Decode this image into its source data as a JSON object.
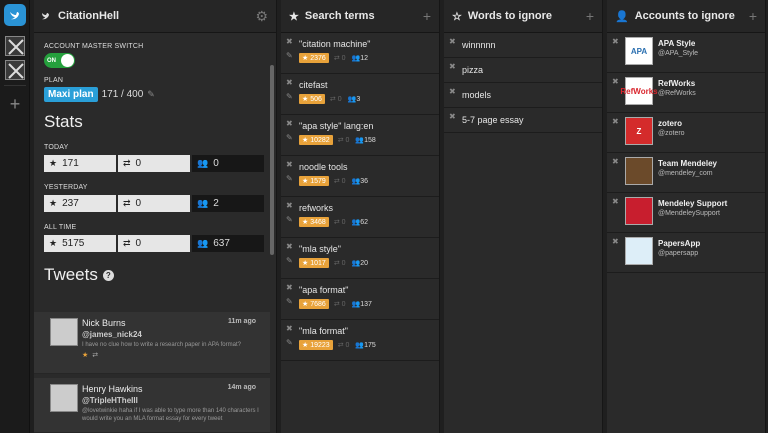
{
  "colors": {
    "accent": "#2a9fd8",
    "orange": "#e8a23a",
    "toggle_on": "#25a03d"
  },
  "account_column": {
    "title": "CitationHell",
    "master_switch_label": "ACCOUNT MASTER SWITCH",
    "toggle_label": "ON",
    "plan_label": "PLAN",
    "plan_name": "Maxi plan",
    "plan_usage": "171 / 400",
    "stats_title": "Stats",
    "periods": [
      {
        "label": "TODAY",
        "stars": "171",
        "retweets": "0",
        "followers": "0"
      },
      {
        "label": "YESTERDAY",
        "stars": "237",
        "retweets": "0",
        "followers": "2"
      },
      {
        "label": "ALL TIME",
        "stars": "5175",
        "retweets": "0",
        "followers": "637"
      }
    ],
    "tweets_title": "Tweets",
    "tweets": [
      {
        "name": "Nick Burns",
        "handle": "@james_nick24",
        "text": "I have no clue how to write a research paper in APA format?",
        "time": "11m ago"
      },
      {
        "name": "Henry Hawkins",
        "handle": "@TripleHTheIII",
        "text": "@lovetwinkie haha if I was able to type more than 140 characters I would write you an MLA format essay for every tweet",
        "time": "14m ago"
      }
    ]
  },
  "search_column": {
    "title": "Search terms",
    "terms": [
      {
        "term": "\"citation machine\"",
        "stars": "2376",
        "retweets": "0",
        "users": "12"
      },
      {
        "term": "citefast",
        "stars": "506",
        "retweets": "0",
        "users": "3"
      },
      {
        "term": "\"apa style\" lang:en",
        "stars": "10282",
        "retweets": "0",
        "users": "158"
      },
      {
        "term": "noodle tools",
        "stars": "1579",
        "retweets": "0",
        "users": "36"
      },
      {
        "term": "refworks",
        "stars": "3468",
        "retweets": "0",
        "users": "62"
      },
      {
        "term": "\"mla style\"",
        "stars": "1017",
        "retweets": "0",
        "users": "20"
      },
      {
        "term": "\"apa format\"",
        "stars": "7686",
        "retweets": "0",
        "users": "137"
      },
      {
        "term": "\"mla format\"",
        "stars": "19223",
        "retweets": "0",
        "users": "175"
      }
    ]
  },
  "ignore_words_column": {
    "title": "Words to ignore",
    "words": [
      "winnnnn",
      "pizza",
      "models",
      "5-7 page essay"
    ]
  },
  "ignore_accounts_column": {
    "title": "Accounts to ignore",
    "accounts": [
      {
        "name": "APA Style",
        "handle": "@APA_Style",
        "logo": "APA"
      },
      {
        "name": "RefWorks",
        "handle": "@RefWorks",
        "logo": "RefWorks"
      },
      {
        "name": "zotero",
        "handle": "@zotero",
        "logo": "Z"
      },
      {
        "name": "Team Mendeley",
        "handle": "@mendeley_com",
        "logo": ""
      },
      {
        "name": "Mendeley Support",
        "handle": "@MendeleySupport",
        "logo": ""
      },
      {
        "name": "PapersApp",
        "handle": "@papersapp",
        "logo": ""
      }
    ]
  }
}
